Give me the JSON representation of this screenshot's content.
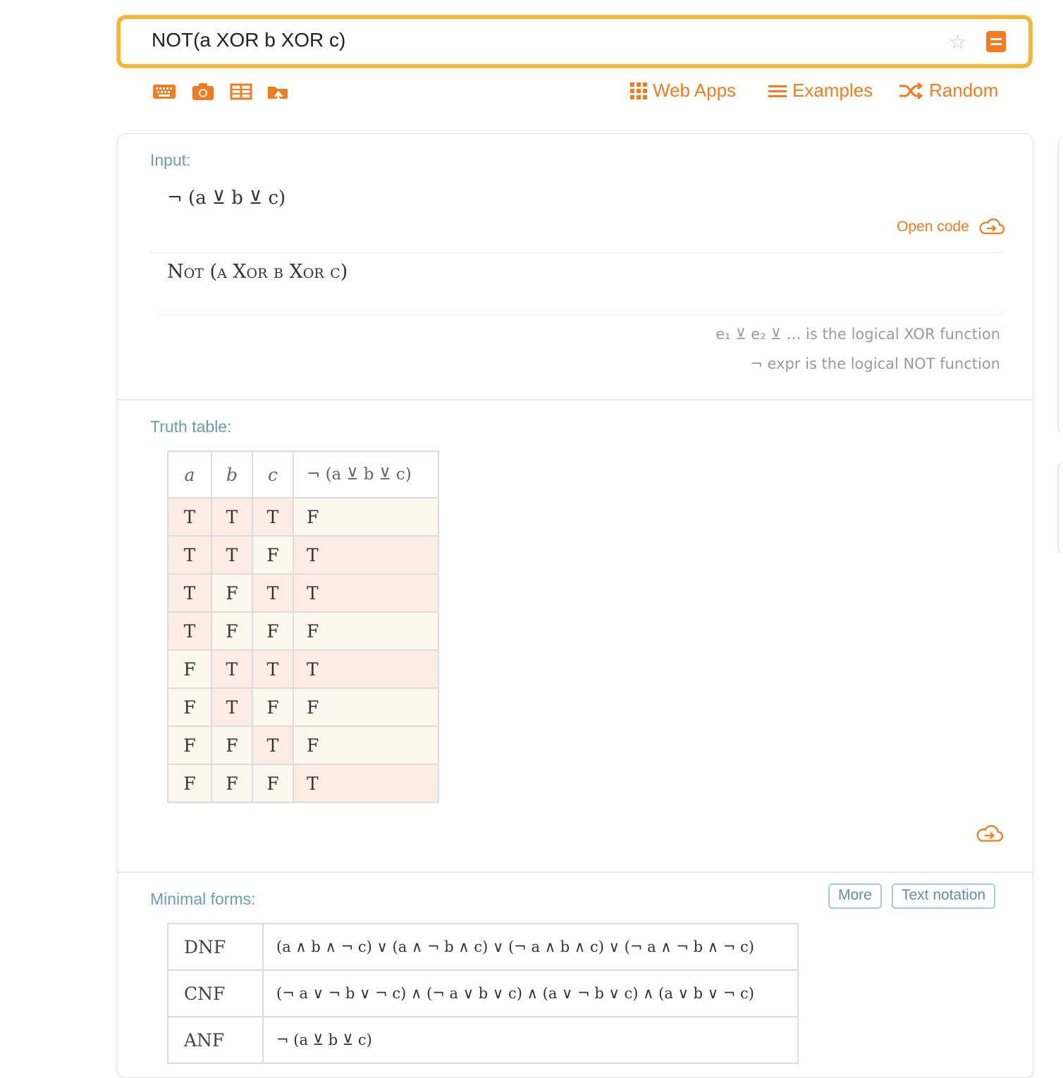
{
  "search": {
    "query": "NOT(a XOR b XOR c)"
  },
  "nav": {
    "web_apps": "Web Apps",
    "examples": "Examples",
    "random": "Random"
  },
  "input_pod": {
    "title": "Input:",
    "expression": "¬ (a ⊻ b ⊻ c)",
    "open_code": "Open code",
    "english": "Not (a Xor b Xor c)",
    "note1": "e₁ ⊻ e₂ ⊻ … is the logical XOR function",
    "note2": "¬ expr is the logical NOT function"
  },
  "truth_pod": {
    "title": "Truth table:",
    "headers": [
      "a",
      "b",
      "c",
      "¬ (a ⊻ b ⊻ c)"
    ],
    "rows": [
      [
        "T",
        "T",
        "T",
        "F"
      ],
      [
        "T",
        "T",
        "F",
        "T"
      ],
      [
        "T",
        "F",
        "T",
        "T"
      ],
      [
        "T",
        "F",
        "F",
        "F"
      ],
      [
        "F",
        "T",
        "T",
        "T"
      ],
      [
        "F",
        "T",
        "F",
        "F"
      ],
      [
        "F",
        "F",
        "T",
        "F"
      ],
      [
        "F",
        "F",
        "F",
        "T"
      ]
    ]
  },
  "minimal_pod": {
    "title": "Minimal forms:",
    "more_button": "More",
    "text_button": "Text notation",
    "rows": [
      {
        "label": "DNF",
        "expr": "(a ∧ b ∧ ¬ c) ∨ (a ∧ ¬ b ∧ c) ∨ (¬ a ∧ b ∧ c) ∨ (¬ a ∧ ¬ b ∧ ¬ c)"
      },
      {
        "label": "CNF",
        "expr": "(¬ a ∨ ¬ b ∨ ¬ c) ∧ (¬ a ∨ b ∨ c) ∧ (a ∨ ¬ b ∨ c) ∧ (a ∨ b ∨ ¬ c)"
      },
      {
        "label": "ANF",
        "expr": "¬ (a ⊻ b ⊻ c)"
      }
    ]
  },
  "colors": {
    "accent": "#f47b20",
    "search_border": "#f7b530",
    "pod_title": "#6a9bb7",
    "true_cell": "#fdece4",
    "false_cell": "#fdf8ed"
  }
}
